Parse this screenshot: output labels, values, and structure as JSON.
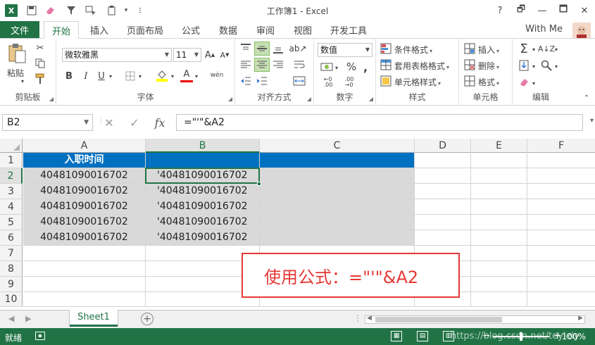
{
  "window": {
    "title": "工作簿1 - Excel",
    "controls": [
      "?",
      "🗗",
      "—",
      "🗖",
      "✕"
    ]
  },
  "tabs": {
    "file": "文件",
    "items": [
      "开始",
      "插入",
      "页面布局",
      "公式",
      "数据",
      "审阅",
      "视图",
      "开发工具"
    ],
    "active": "开始",
    "user": "With Me"
  },
  "ribbon": {
    "clipboard": {
      "label": "剪贴板",
      "paste": "粘贴"
    },
    "font": {
      "label": "字体",
      "name": "微软雅黑",
      "size": "11",
      "phonetic": "wén"
    },
    "alignment": {
      "label": "对齐方式"
    },
    "number": {
      "label": "数字",
      "format": "数值"
    },
    "styles": {
      "label": "样式",
      "conditional": "条件格式",
      "table": "套用表格格式",
      "cell": "单元格样式"
    },
    "cells": {
      "label": "单元格",
      "insert": "插入",
      "delete": "删除",
      "format": "格式"
    },
    "editing": {
      "label": "编辑"
    }
  },
  "formula_bar": {
    "name_box": "B2",
    "formula": "=\"'\"&A2"
  },
  "grid": {
    "columns": [
      "A",
      "B",
      "C",
      "D",
      "E",
      "F"
    ],
    "selected_column": "B",
    "rows": [
      "1",
      "2",
      "3",
      "4",
      "5",
      "6",
      "7",
      "8",
      "9",
      "10"
    ],
    "selected_row": "2",
    "header_row": {
      "A": "入职时间",
      "B": ""
    },
    "data": [
      {
        "A": "40481090016702",
        "B": "'40481090016702"
      },
      {
        "A": "40481090016702",
        "B": "'40481090016702"
      },
      {
        "A": "40481090016702",
        "B": "'40481090016702"
      },
      {
        "A": "40481090016702",
        "B": "'40481090016702"
      },
      {
        "A": "40481090016702",
        "B": "'40481090016702"
      }
    ],
    "note": "使用公式：=\"'\"&A2"
  },
  "sheets": {
    "tabs": [
      "Sheet1"
    ],
    "active": "Sheet1"
  },
  "status": {
    "text": "就绪",
    "zoom": "100%",
    "watermark": "https://blog.csdn.net/teyieiy"
  },
  "colors": {
    "accent": "#217346",
    "header_fill": "#0070c0",
    "gray_fill": "#d9d9d9",
    "note_red": "#e53935"
  }
}
